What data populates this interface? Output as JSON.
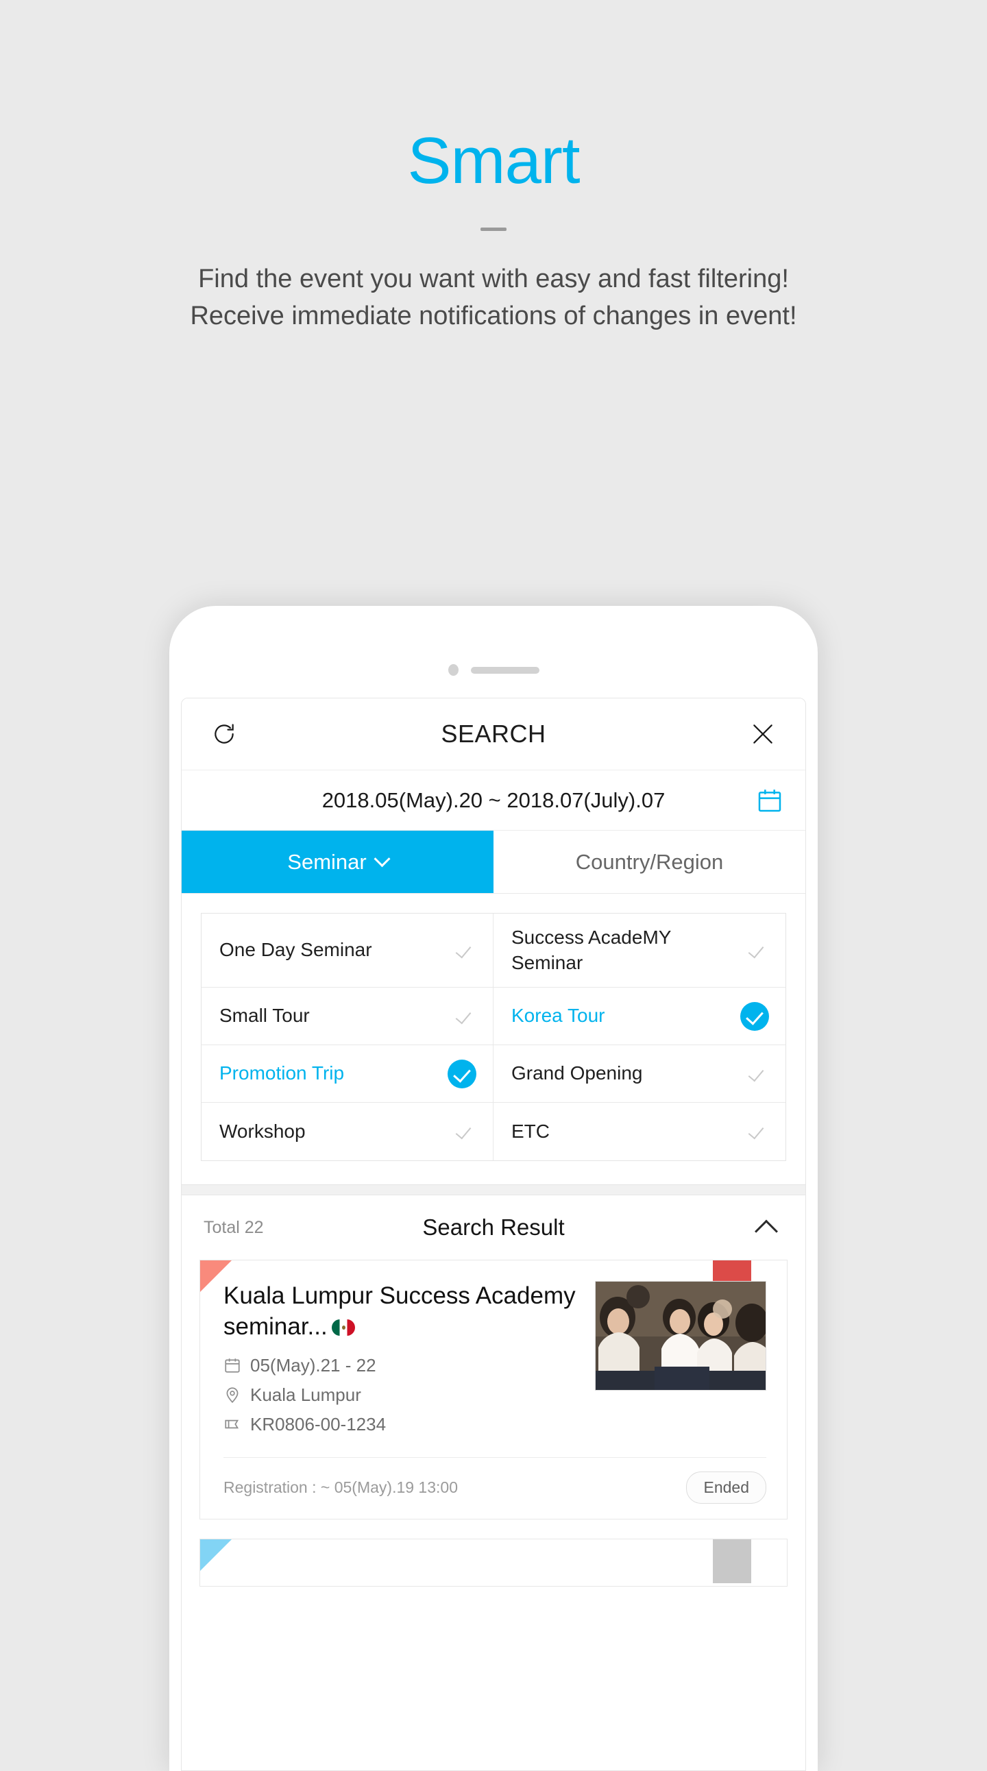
{
  "hero": {
    "title": "Smart",
    "subtitle_line1": "Find the event you want with easy and fast filtering!",
    "subtitle_line2": "Receive immediate notifications of changes in event!"
  },
  "app": {
    "appbar": {
      "title": "SEARCH",
      "refresh_icon": "refresh-icon",
      "close_icon": "close-icon"
    },
    "date_bar": {
      "range": "2018.05(May).20 ~ 2018.07(July).07",
      "calendar_icon": "calendar-icon"
    },
    "tabs": [
      {
        "label": "Seminar",
        "active": true,
        "has_chevron": true
      },
      {
        "label": "Country/Region",
        "active": false,
        "has_chevron": false
      }
    ],
    "filters": [
      {
        "label": "One Day Seminar",
        "selected": false
      },
      {
        "label": "Success AcadeMY Seminar",
        "selected": false
      },
      {
        "label": "Small Tour",
        "selected": false
      },
      {
        "label": "Korea Tour",
        "selected": true
      },
      {
        "label": "Promotion Trip",
        "selected": true
      },
      {
        "label": "Grand Opening",
        "selected": false
      },
      {
        "label": "Workshop",
        "selected": false
      },
      {
        "label": "ETC",
        "selected": false
      }
    ],
    "results": {
      "total_label": "Total 22",
      "title": "Search Result",
      "collapse_icon": "chevron-up-icon",
      "items": [
        {
          "title": "Kuala Lumpur Success Academy seminar...",
          "flag": "mexico-flag",
          "date": "05(May).21 - 22",
          "location": "Kuala Lumpur",
          "code": "KR0806-00-1234",
          "registration": "Registration : ~ 05(May).19  13:00",
          "status": "Ended",
          "corner_color": "#f98a7c",
          "ribbon_color": "#dc4b48"
        }
      ],
      "next_item_corner_color": "#82d4f5",
      "next_item_ribbon_color": "#c8c8c8"
    }
  },
  "colors": {
    "accent": "#00b3ed",
    "page_bg": "#eaeaea",
    "text_primary": "#1a1a1a",
    "text_muted": "#6d6d6d"
  }
}
